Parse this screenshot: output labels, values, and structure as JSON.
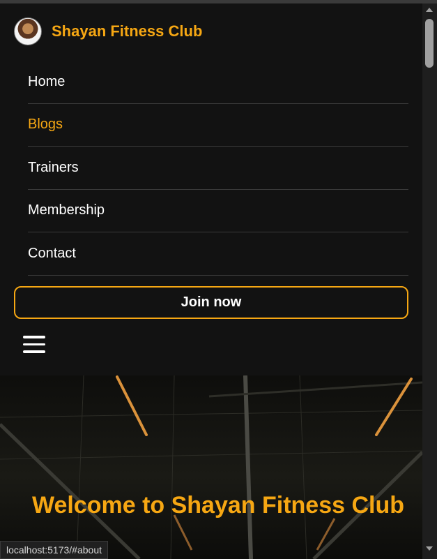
{
  "brand": {
    "name": "Shayan Fitness Club",
    "logo_icon": "bodybuilder-logo-icon"
  },
  "nav": {
    "items": [
      {
        "label": "Home",
        "active": false
      },
      {
        "label": "Blogs",
        "active": true
      },
      {
        "label": "Trainers",
        "active": false
      },
      {
        "label": "Membership",
        "active": false
      },
      {
        "label": "Contact",
        "active": false
      }
    ]
  },
  "join_button": {
    "label": "Join now"
  },
  "menu_icon": "hamburger-menu-icon",
  "hero": {
    "title": "Welcome to Shayan Fitness Club"
  },
  "status_bar": {
    "url": "localhost:5173/#about"
  },
  "colors": {
    "accent": "#f6a713",
    "background": "#121212",
    "text": "#ffffff",
    "divider": "#3b3b3b"
  }
}
